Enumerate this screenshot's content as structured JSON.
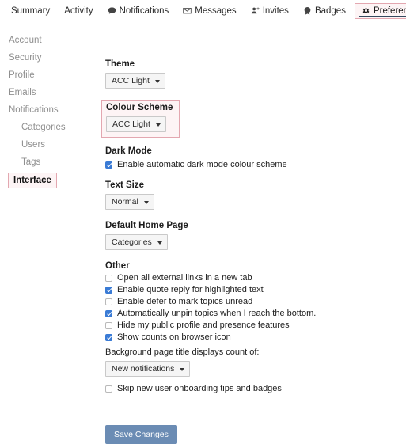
{
  "nav": {
    "items": [
      {
        "label": "Summary",
        "icon": "none",
        "active": false
      },
      {
        "label": "Activity",
        "icon": "none",
        "active": false
      },
      {
        "label": "Notifications",
        "icon": "speech-bubble-icon",
        "active": false
      },
      {
        "label": "Messages",
        "icon": "envelope-icon",
        "active": false
      },
      {
        "label": "Invites",
        "icon": "person-add-icon",
        "active": false
      },
      {
        "label": "Badges",
        "icon": "badge-icon",
        "active": false
      },
      {
        "label": "Preferences",
        "icon": "gear-icon",
        "active": true
      }
    ]
  },
  "sidebar": {
    "items": [
      {
        "label": "Account",
        "sub": false,
        "selected": false
      },
      {
        "label": "Security",
        "sub": false,
        "selected": false
      },
      {
        "label": "Profile",
        "sub": false,
        "selected": false
      },
      {
        "label": "Emails",
        "sub": false,
        "selected": false
      },
      {
        "label": "Notifications",
        "sub": false,
        "selected": false
      },
      {
        "label": "Categories",
        "sub": true,
        "selected": false
      },
      {
        "label": "Users",
        "sub": true,
        "selected": false
      },
      {
        "label": "Tags",
        "sub": true,
        "selected": false
      },
      {
        "label": "Interface",
        "sub": false,
        "selected": true
      }
    ]
  },
  "main": {
    "theme": {
      "label": "Theme",
      "value": "ACC Light",
      "highlighted": false
    },
    "colour_scheme": {
      "label": "Colour Scheme",
      "value": "ACC Light",
      "highlighted": true
    },
    "dark_mode": {
      "label": "Dark Mode",
      "checkbox_label": "Enable automatic dark mode colour scheme",
      "checked": true
    },
    "text_size": {
      "label": "Text Size",
      "value": "Normal",
      "highlighted": false
    },
    "default_home_page": {
      "label": "Default Home Page",
      "value": "Categories",
      "highlighted": false
    },
    "other": {
      "label": "Other",
      "options": [
        {
          "label": "Open all external links in a new tab",
          "checked": false
        },
        {
          "label": "Enable quote reply for highlighted text",
          "checked": true
        },
        {
          "label": "Enable defer to mark topics unread",
          "checked": false
        },
        {
          "label": "Automatically unpin topics when I reach the bottom.",
          "checked": true
        },
        {
          "label": "Hide my public profile and presence features",
          "checked": false
        },
        {
          "label": "Show counts on browser icon",
          "checked": true
        }
      ],
      "background_count_label": "Background page title displays count of:",
      "background_count_value": "New notifications",
      "skip_onboarding": {
        "label": "Skip new user onboarding tips and badges",
        "checked": false
      }
    },
    "save_label": "Save Changes"
  },
  "colors": {
    "highlight_border": "#e3a7b0",
    "highlight_fill": "#fdf4f5",
    "active_tab_underline": "#34495e",
    "checkbox_checked": "#3a7bd5",
    "save_button": "#6b8cb4",
    "sidebar_text": "#8f8f8f"
  }
}
